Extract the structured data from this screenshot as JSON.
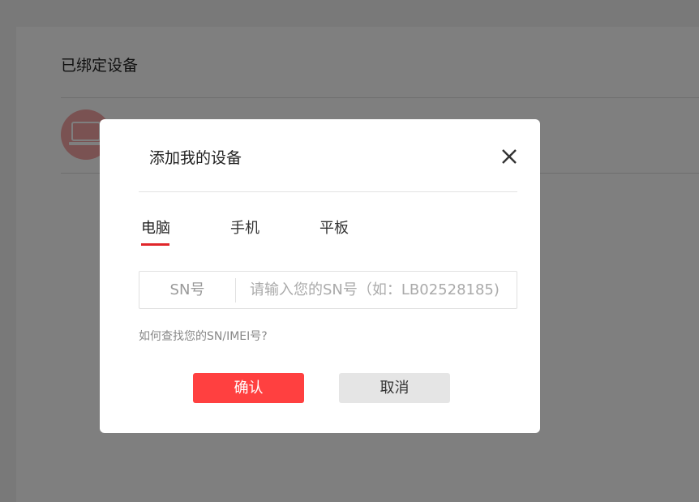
{
  "page": {
    "section_title": "已绑定设备"
  },
  "modal": {
    "title": "添加我的设备",
    "tabs": [
      {
        "label": "电脑",
        "active": true
      },
      {
        "label": "手机",
        "active": false
      },
      {
        "label": "平板",
        "active": false
      }
    ],
    "sn_field": {
      "label": "SN号",
      "value": "",
      "placeholder": "请输入您的SN号（如：LB02528185)"
    },
    "help_link": "如何查找您的SN/IMEI号?",
    "confirm_label": "确认",
    "cancel_label": "取消"
  },
  "colors": {
    "accent": "#e0262a",
    "confirm_button": "#ff4040",
    "cancel_button": "#e5e5e5",
    "avatar": "#f5a5a5"
  },
  "icons": {
    "close": "close-icon",
    "device": "laptop-icon"
  }
}
